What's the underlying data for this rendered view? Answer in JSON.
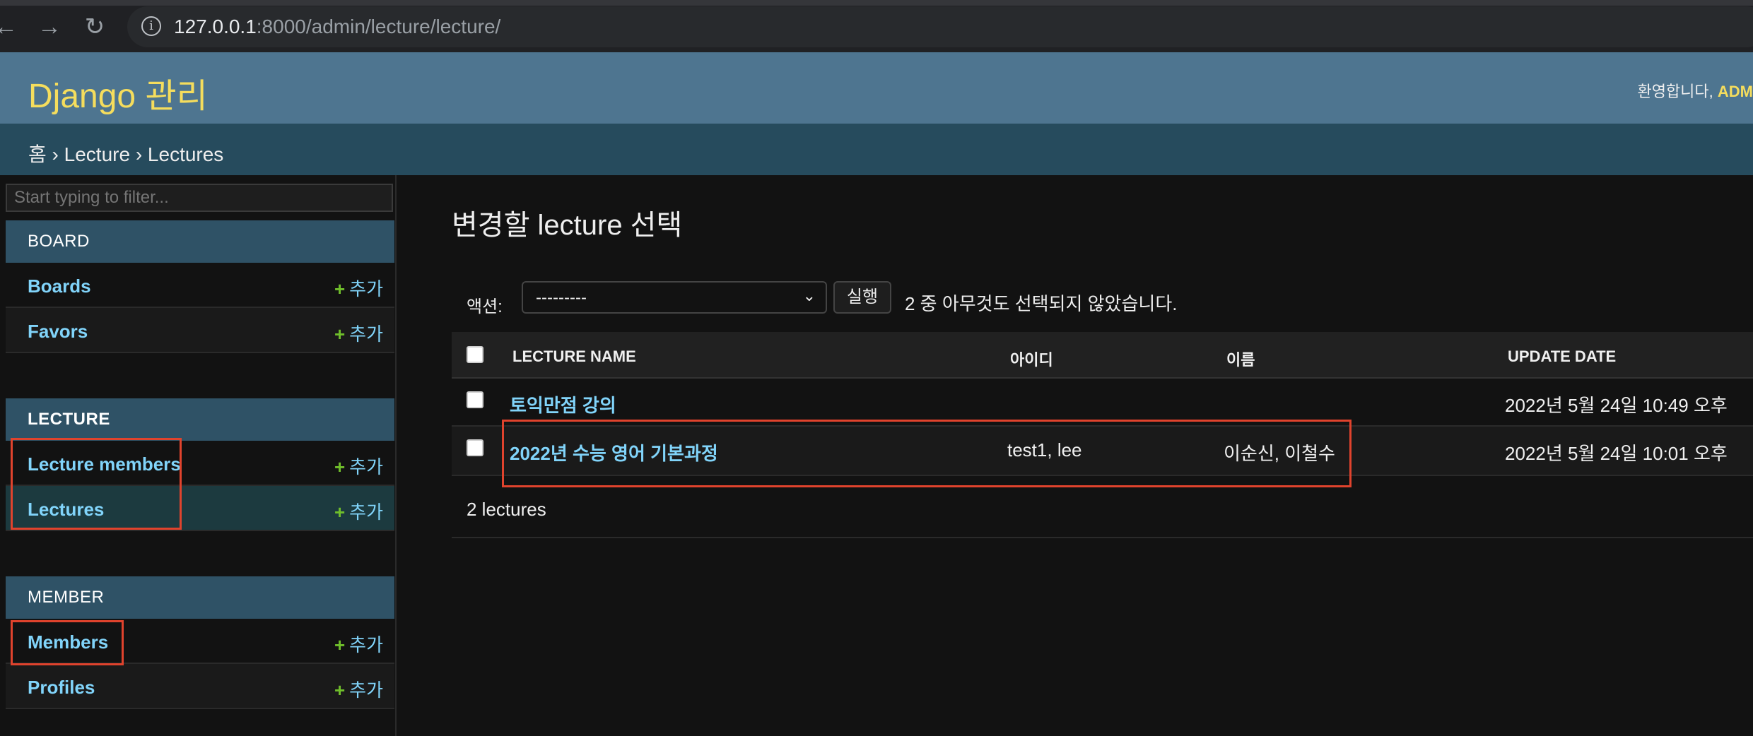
{
  "browser": {
    "url_host": "127.0.0.1",
    "url_rest": ":8000/admin/lecture/lecture/",
    "back_icon": "←",
    "forward_icon": "→",
    "reload_icon": "↻",
    "info_icon": "i"
  },
  "header": {
    "brand": "Django 관리",
    "welcome": "환영합니다, ",
    "user": "ADM"
  },
  "breadcrumbs": "홈 › Lecture › Lectures",
  "sidebar": {
    "filter_placeholder": "Start typing to filter...",
    "add_label": "추가",
    "apps": [
      {
        "name": "BOARD",
        "models": [
          "Boards",
          "Favors"
        ]
      },
      {
        "name": "LECTURE",
        "models": [
          "Lecture members",
          "Lectures"
        ]
      },
      {
        "name": "MEMBER",
        "models": [
          "Members",
          "Profiles"
        ]
      }
    ]
  },
  "content": {
    "title": "변경할 lecture 선택",
    "actions_label": "액션:",
    "action_selected": "---------",
    "run_label": "실행",
    "selection_counter": "2 중 아무것도 선택되지 않았습니다.",
    "columns": [
      "LECTURE NAME",
      "아이디",
      "이름",
      "UPDATE DATE"
    ],
    "rows": [
      {
        "name": "토익만점 강의",
        "ids": "",
        "names": "",
        "date": "2022년 5월 24일 10:49 오후"
      },
      {
        "name": "2022년 수능 영어 기본과정",
        "ids": "test1, lee",
        "names": "이순신, 이철수",
        "date": "2022년 5월 24일 10:01 오후"
      }
    ],
    "paginator": "2 lectures"
  },
  "colors": {
    "header_bg": "#4e7590",
    "breadcrumb_bg": "#264b5d",
    "brand_yellow": "#f5dd5d",
    "link_blue": "#81d4fa",
    "add_green": "#70bf2b",
    "highlight_red": "#e0432d"
  }
}
